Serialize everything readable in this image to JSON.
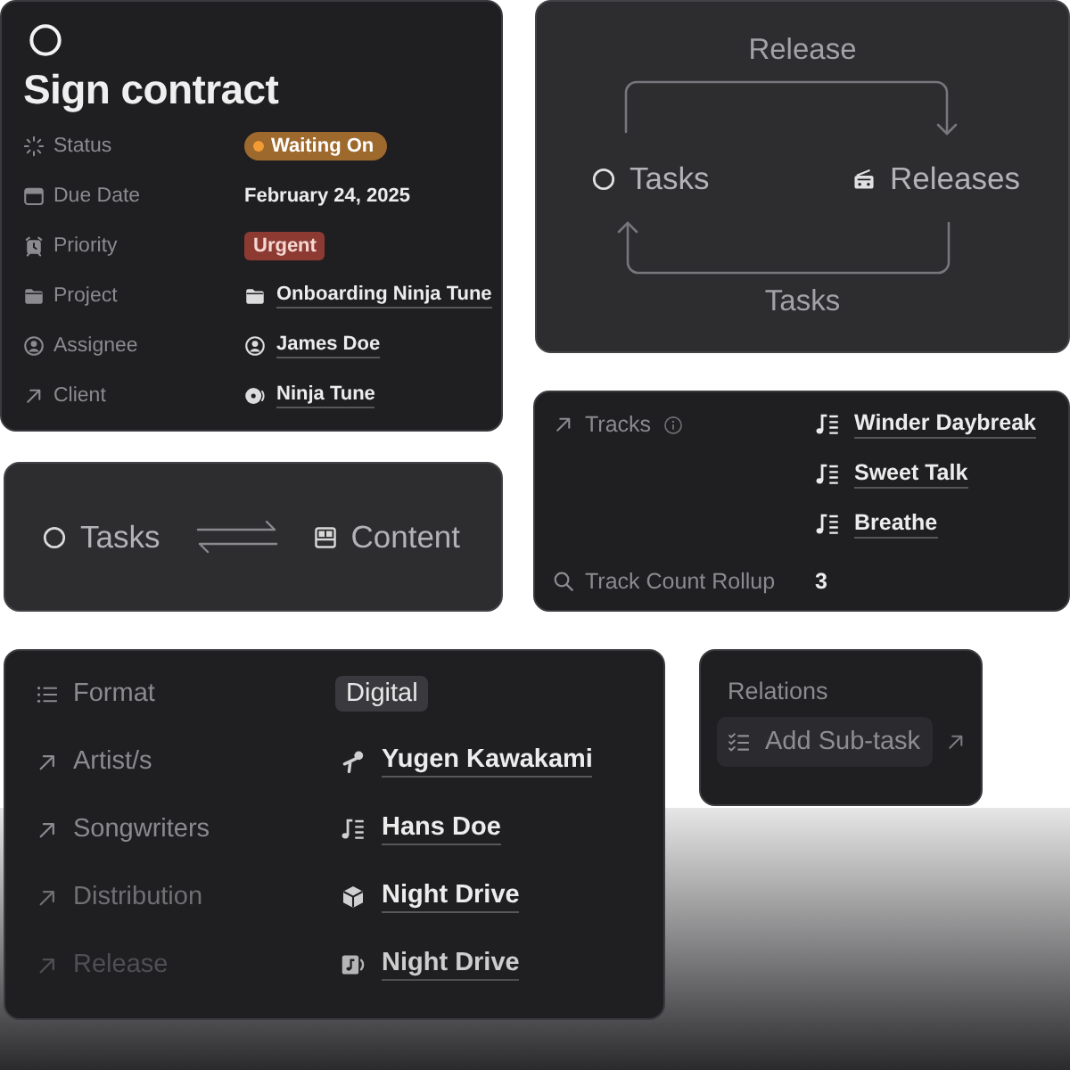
{
  "task_card": {
    "title": "Sign contract",
    "properties": [
      {
        "label": "Status",
        "kind": "status",
        "value": "Waiting On",
        "color": "#f39b35"
      },
      {
        "label": "Due Date",
        "kind": "date",
        "value": "February 24, 2025"
      },
      {
        "label": "Priority",
        "kind": "select",
        "value": "Urgent",
        "color": "#8d3a33"
      },
      {
        "label": "Project",
        "kind": "relation",
        "value": "Onboarding Ninja Tune"
      },
      {
        "label": "Assignee",
        "kind": "relation",
        "value": "James Doe"
      },
      {
        "label": "Client",
        "kind": "relation",
        "value": "Ninja Tune"
      }
    ]
  },
  "relation_diagram": {
    "top_label": "Release",
    "source": "Tasks",
    "target": "Releases",
    "bottom_label": "Tasks"
  },
  "link_card": {
    "source": "Tasks",
    "target": "Content"
  },
  "tracks_card": {
    "properties": [
      {
        "label": "Tracks",
        "kind": "relation",
        "values": [
          "Winder Daybreak",
          "Sweet Talk",
          "Breathe"
        ]
      },
      {
        "label": "Track Count Rollup",
        "kind": "number",
        "value": "3"
      }
    ]
  },
  "release_card": {
    "properties": [
      {
        "label": "Format",
        "kind": "select",
        "value": "Digital"
      },
      {
        "label": "Artist/s",
        "kind": "relation",
        "value": "Yugen Kawakami"
      },
      {
        "label": "Songwriters",
        "kind": "relation",
        "value": "Hans Doe"
      },
      {
        "label": "Distribution",
        "kind": "relation",
        "value": "Night Drive"
      },
      {
        "label": "Release",
        "kind": "relation",
        "value": "Night Drive"
      }
    ]
  },
  "relations_card": {
    "title": "Relations",
    "button": "Add Sub-task"
  }
}
